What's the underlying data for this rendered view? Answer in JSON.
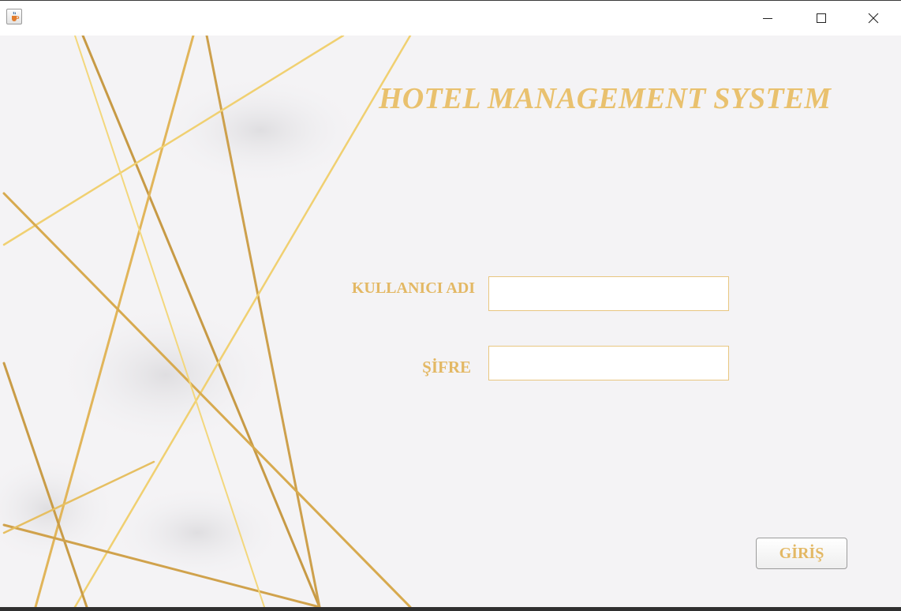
{
  "window": {
    "app_icon": "java-cup-icon",
    "controls": {
      "minimize_icon": "minimize-icon",
      "maximize_icon": "maximize-icon",
      "close_icon": "close-icon"
    }
  },
  "header": {
    "title": "HOTEL MANAGEMENT SYSTEM"
  },
  "form": {
    "username_label": "KULLANICI ADI",
    "username_value": "",
    "password_label": "ŞİFRE",
    "password_value": "",
    "submit_label": "GİRİŞ"
  },
  "colors": {
    "accent_gold": "#e3b864",
    "background": "#f4f3f5"
  }
}
